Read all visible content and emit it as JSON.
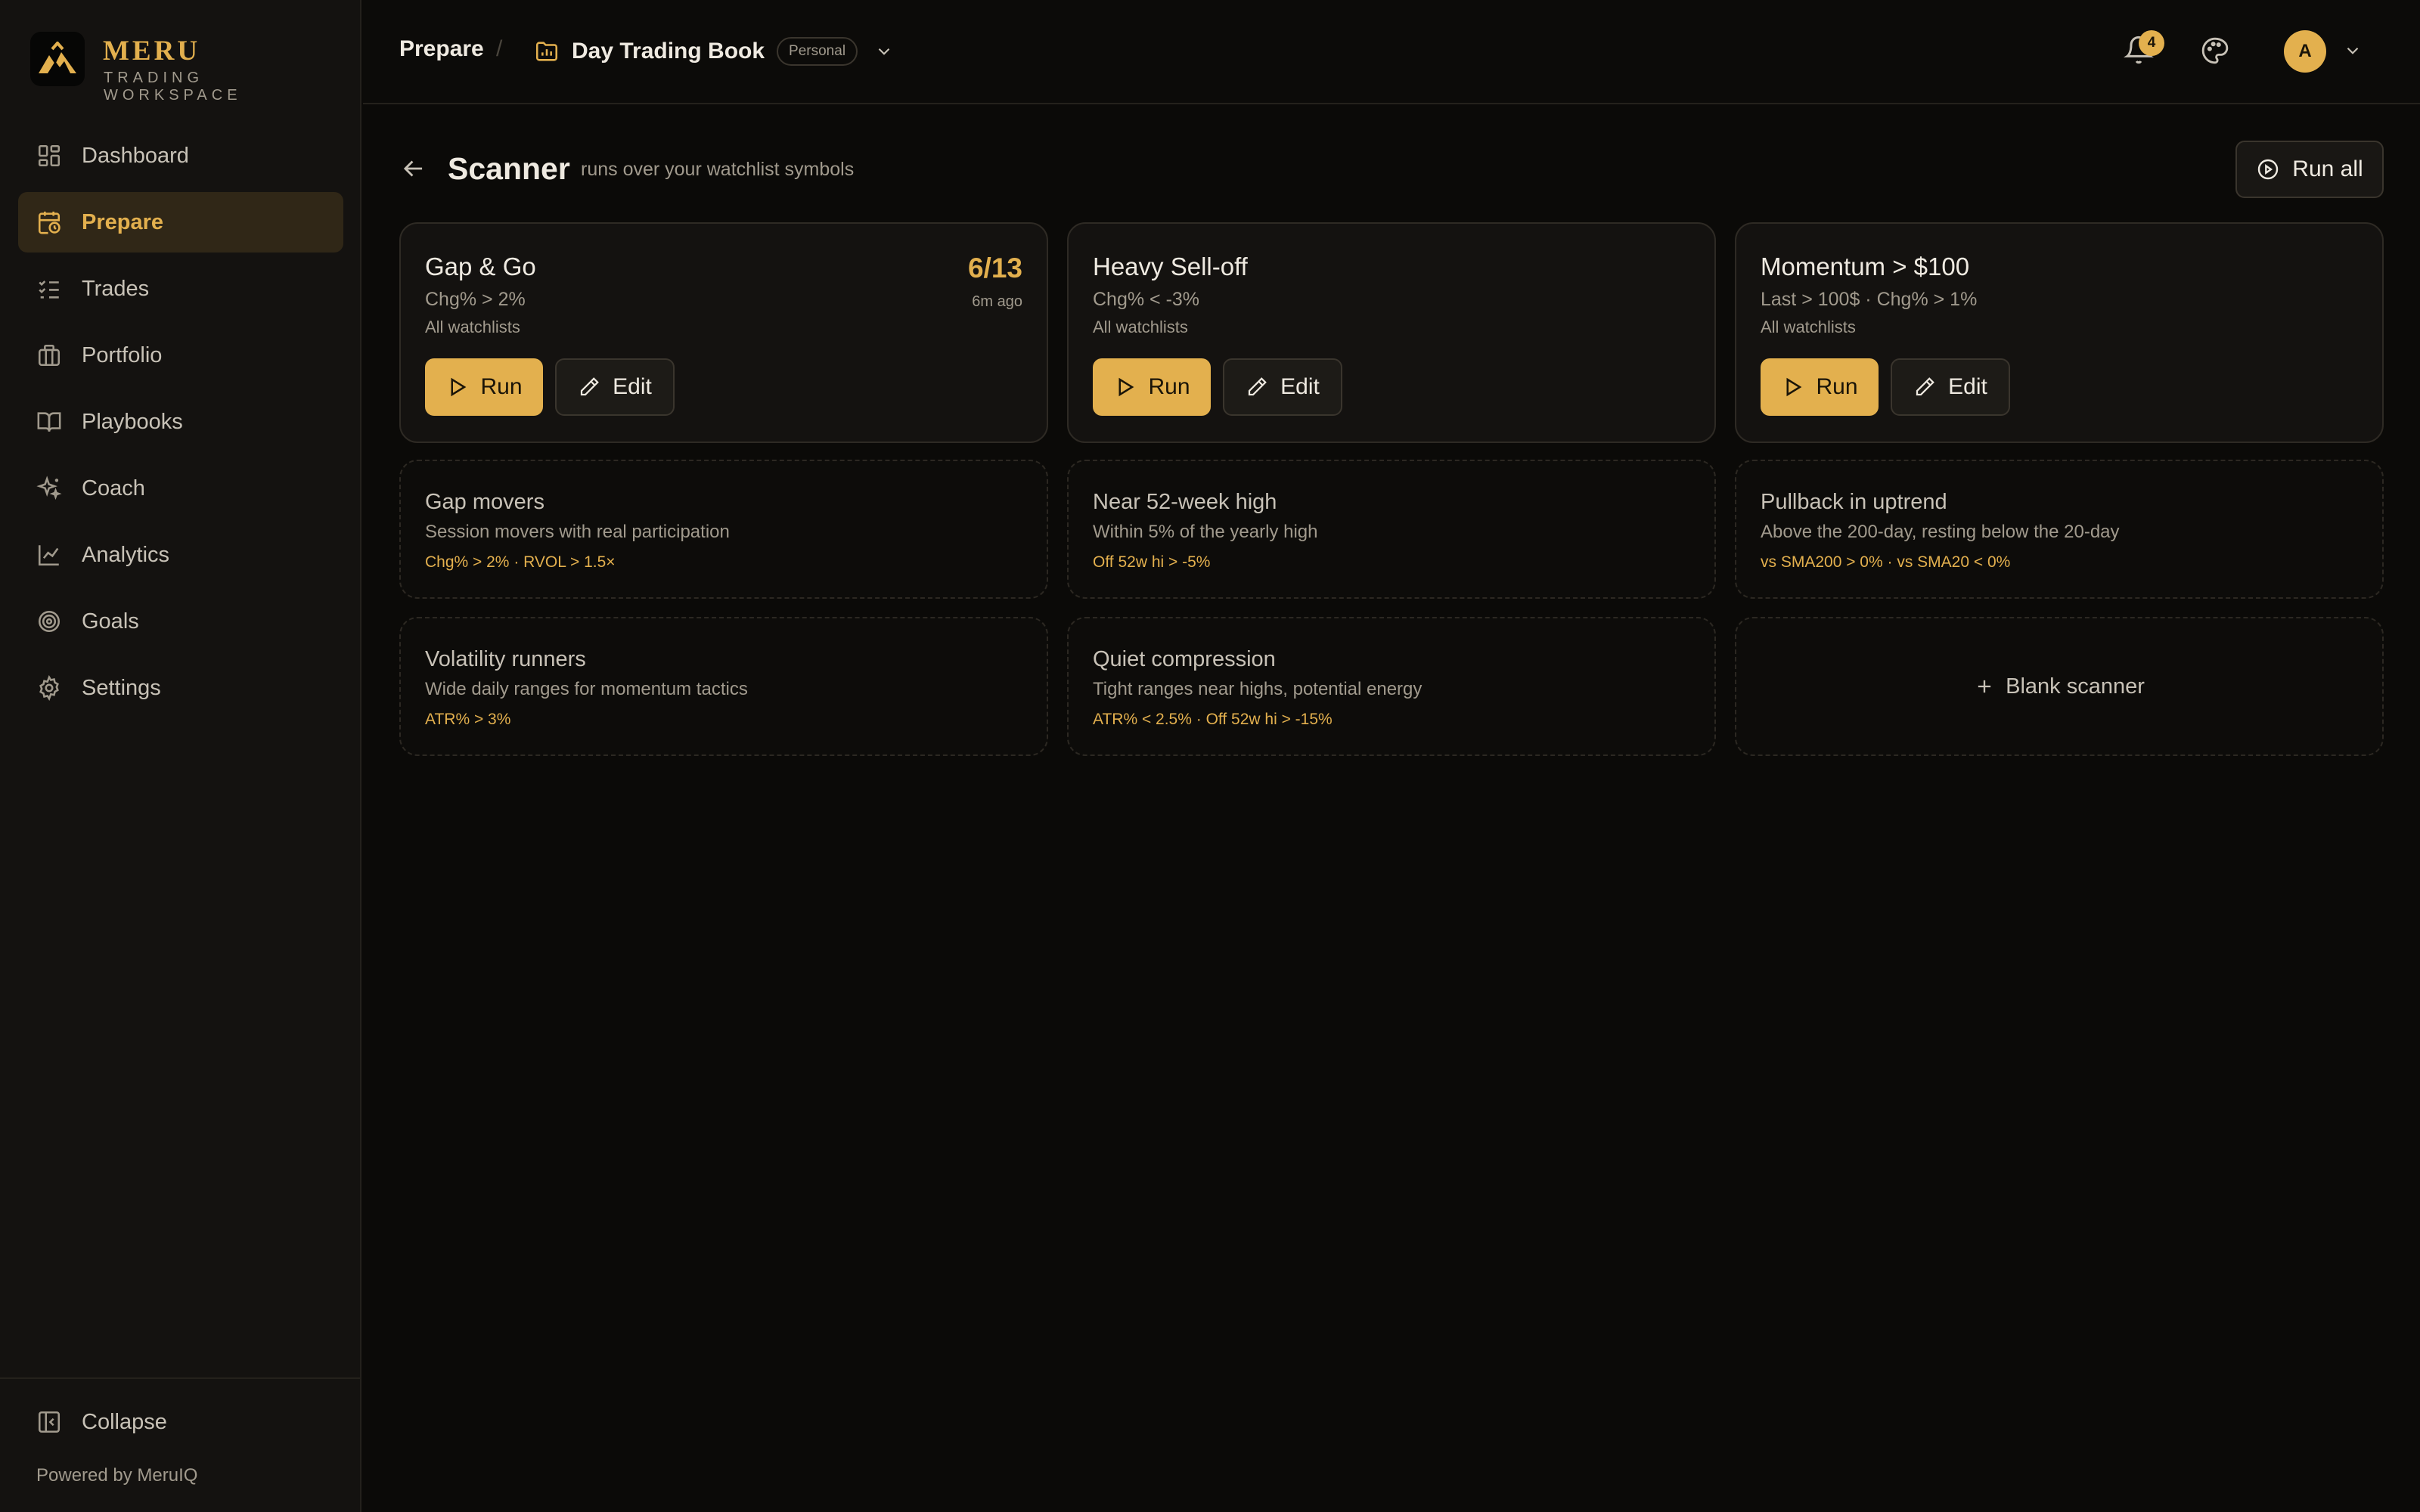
{
  "brand": {
    "name": "MERU",
    "subtitle": "TRADING WORKSPACE"
  },
  "sidebar": {
    "items": [
      {
        "label": "Dashboard",
        "icon": "dashboard-icon"
      },
      {
        "label": "Prepare",
        "icon": "calendar-clock-icon",
        "active": true
      },
      {
        "label": "Trades",
        "icon": "list-checks-icon"
      },
      {
        "label": "Portfolio",
        "icon": "briefcase-icon"
      },
      {
        "label": "Playbooks",
        "icon": "book-open-icon"
      },
      {
        "label": "Coach",
        "icon": "sparkles-icon"
      },
      {
        "label": "Analytics",
        "icon": "line-chart-icon"
      },
      {
        "label": "Goals",
        "icon": "target-icon"
      },
      {
        "label": "Settings",
        "icon": "gear-icon"
      }
    ],
    "collapse_label": "Collapse",
    "powered_by": "Powered by MeruIQ"
  },
  "topbar": {
    "breadcrumb_section": "Prepare",
    "separator": "/",
    "book_name": "Day Trading Book",
    "book_badge": "Personal",
    "notification_count": "4",
    "avatar_initial": "A"
  },
  "page": {
    "title": "Scanner",
    "subtitle": "runs over your watchlist symbols",
    "run_all_label": "Run all"
  },
  "scanners": [
    {
      "name": "Gap & Go",
      "criteria": "Chg% > 2%",
      "scope": "All watchlists",
      "count": "6/13",
      "ago": "6m ago",
      "run_label": "Run",
      "edit_label": "Edit"
    },
    {
      "name": "Heavy Sell-off",
      "criteria": "Chg% < -3%",
      "scope": "All watchlists",
      "run_label": "Run",
      "edit_label": "Edit"
    },
    {
      "name": "Momentum > $100",
      "criteria": "Last > 100$ · Chg% > 1%",
      "scope": "All watchlists",
      "run_label": "Run",
      "edit_label": "Edit"
    }
  ],
  "templates": [
    {
      "name": "Gap movers",
      "description": "Session movers with real participation",
      "rule": "Chg% > 2% · RVOL > 1.5×"
    },
    {
      "name": "Near 52-week high",
      "description": "Within 5% of the yearly high",
      "rule": "Off 52w hi > -5%"
    },
    {
      "name": "Pullback in uptrend",
      "description": "Above the 200-day, resting below the 20-day",
      "rule": "vs SMA200 > 0% · vs SMA20 < 0%"
    },
    {
      "name": "Volatility runners",
      "description": "Wide daily ranges for momentum tactics",
      "rule": "ATR% > 3%"
    },
    {
      "name": "Quiet compression",
      "description": "Tight ranges near highs, potential energy",
      "rule": "ATR% < 2.5% · Off 52w hi > -15%"
    }
  ],
  "blank_scanner_label": "Blank scanner",
  "colors": {
    "accent": "#e3b04e",
    "background": "#0b0a08",
    "sidebar": "#141210",
    "active_nav": "#302717"
  }
}
